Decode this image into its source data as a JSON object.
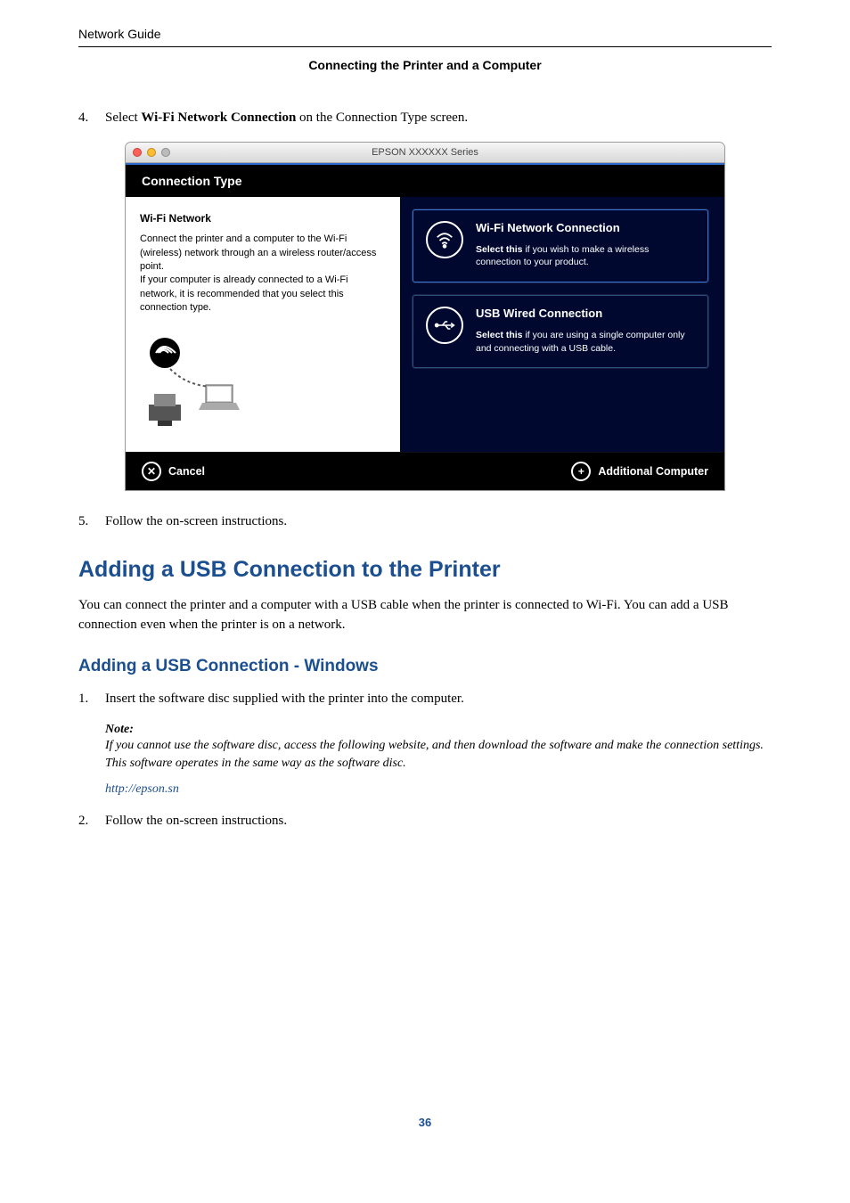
{
  "header": {
    "guide_title": "Network Guide",
    "section_title": "Connecting the Printer and a Computer"
  },
  "steps_top": [
    {
      "num": "4.",
      "prefix": "Select ",
      "bold": "Wi-Fi Network Connection",
      "suffix": " on the Connection Type screen."
    }
  ],
  "screenshot": {
    "window_title": "EPSON XXXXXX Series",
    "header_bar": "Connection Type",
    "left": {
      "title": "Wi-Fi Network",
      "body": "Connect the printer and a computer to the Wi-Fi (wireless) network through an a wireless router/access point.\nIf your computer is already connected to a Wi-Fi network, it is recommended that you select this connection type."
    },
    "options": [
      {
        "title": "Wi-Fi Network Connection",
        "sub_lead": "Select this",
        "sub_rest": " if you wish to make a wireless connection to your product."
      },
      {
        "title": "USB Wired Connection",
        "sub_lead": "Select this",
        "sub_rest": " if you are using a single computer only and connecting with a USB cable."
      }
    ],
    "footer": {
      "cancel": "Cancel",
      "additional": "Additional Computer"
    }
  },
  "steps_after_image": [
    {
      "num": "5.",
      "text": "Follow the on-screen instructions."
    }
  ],
  "h2": "Adding a USB Connection to the Printer",
  "usb_intro": "You can connect the printer and a computer with a USB cable when the printer is connected to Wi-Fi. You can add a USB connection even when the printer is on a network.",
  "h3": "Adding a USB Connection - Windows",
  "usb_steps": [
    {
      "num": "1.",
      "text": "Insert the software disc supplied with the printer into the computer.",
      "note_label": "Note:",
      "note_body": "If you cannot use the software disc, access the following website, and then download the software and make the connection settings. This software operates in the same way as the software disc.",
      "link": "http://epson.sn"
    },
    {
      "num": "2.",
      "text": "Follow the on-screen instructions."
    }
  ],
  "page_number": "36"
}
